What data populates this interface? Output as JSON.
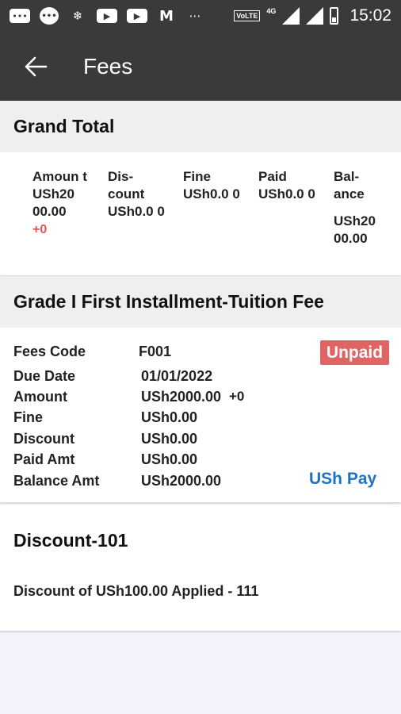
{
  "status_bar": {
    "time": "15:02",
    "volte": "VoLTE",
    "network": "4G",
    "icons": [
      "message-icon",
      "chat-bubble-icon",
      "snowflake-icon",
      "youtube-icon",
      "youtube-icon",
      "gmail-icon",
      "more-dots-icon"
    ]
  },
  "app_bar": {
    "title": "Fees"
  },
  "grand_total": {
    "heading": "Grand Total",
    "columns": [
      {
        "label": "Amoun t",
        "value": "USh20 00.00",
        "extra": "+0"
      },
      {
        "label": "Dis- count",
        "value": "USh0.0 0",
        "extra": ""
      },
      {
        "label": "Fine",
        "value": "USh0.0 0",
        "extra": ""
      },
      {
        "label": "Paid",
        "value": "USh0.0 0",
        "extra": ""
      },
      {
        "label": "Bal- ance",
        "value": "USh20 00.00",
        "extra": ""
      }
    ]
  },
  "fee": {
    "heading": "Grade I First Installment-Tuition Fee",
    "status": "Unpaid",
    "rows": [
      {
        "label": "Fees Code",
        "value": "F001"
      },
      {
        "label": "Due Date",
        "value": "01/01/2022"
      },
      {
        "label": "Amount",
        "value": "USh2000.00"
      },
      {
        "label": "Fine",
        "value": "USh0.00"
      },
      {
        "label": "Discount",
        "value": "USh0.00"
      },
      {
        "label": "Paid Amt",
        "value": "USh0.00"
      },
      {
        "label": "Balance Amt",
        "value": "USh2000.00"
      }
    ],
    "amount_extra": "+0",
    "pay_button": "USh Pay"
  },
  "discount": {
    "title": "Discount-101",
    "text": "Discount of USh100.00 Applied - 111"
  },
  "colors": {
    "bar": "#3a3a3a",
    "unpaid": "#e06464",
    "link": "#1e72c8",
    "extra": "#e05454"
  }
}
